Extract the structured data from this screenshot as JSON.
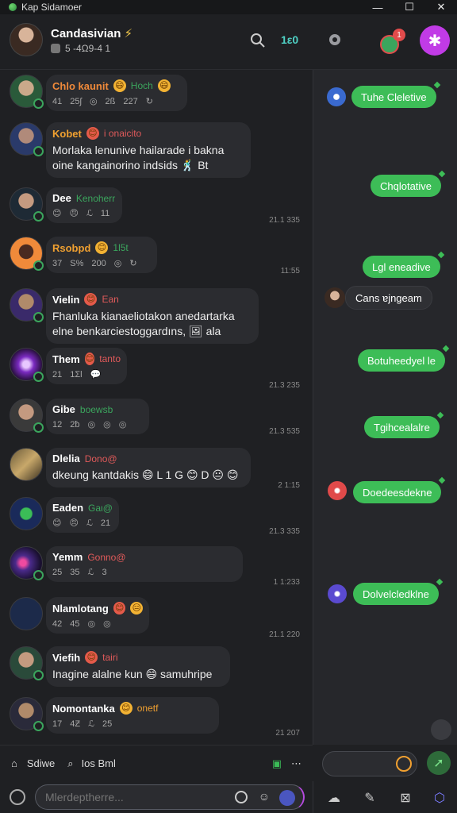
{
  "window": {
    "title": "Kap Sidamoer",
    "controls": [
      "—",
      "☐",
      "✕"
    ]
  },
  "header": {
    "contact_name": "Candasivian",
    "sparkle": "⚡",
    "subtitle": "5 -4Ω9-4 1",
    "count_label": "1ε0",
    "notification_badge": "1"
  },
  "messages": [
    {
      "name": "Chlo kaunit",
      "name_color": "#f08a3a",
      "tag": "Hoch",
      "tag_color": "#3ba55d",
      "meta": [
        "41",
        "25ʃ",
        "◎",
        "2ß",
        "227",
        "↻"
      ],
      "time": "",
      "text": ""
    },
    {
      "name": "Kobet",
      "name_color": "#f0a030",
      "tag": "i onaicito",
      "tag_color": "#e05a5a",
      "meta": [],
      "time": "",
      "text": "Morlaka lenunive hailarade i bakna oine kangainorino indsids 🕺 Bt"
    },
    {
      "name": "Dee",
      "name_color": "#ffffff",
      "tag": "Kenoherr",
      "tag_color": "#3ba55d",
      "meta": [
        "😊",
        "😠",
        "ℒ",
        "11"
      ],
      "time": "21.1 335",
      "text": ""
    },
    {
      "name": "Rsobpd",
      "name_color": "#f0a030",
      "tag": "1l5t",
      "tag_color": "#3ba55d",
      "meta": [
        "37",
        "S%",
        "200",
        "◎",
        "↻"
      ],
      "time": "11:55",
      "text": ""
    },
    {
      "name": "Vielin",
      "name_color": "#ffffff",
      "tag": "Ean",
      "tag_color": "#e05a5a",
      "meta": [],
      "time": "",
      "text": "Fhanluka kianaeliotakon anedartarka elne benkarciestoggardıns, 🖼 ala"
    },
    {
      "name": "Them",
      "name_color": "#ffffff",
      "tag": "tanto",
      "tag_color": "#e05a5a",
      "meta": [
        "21",
        "1Ʃl",
        "💬"
      ],
      "time": "21.3 235",
      "text": ""
    },
    {
      "name": "Gibe",
      "name_color": "#ffffff",
      "tag": "boewsb",
      "tag_color": "#3ba55d",
      "meta": [
        "12",
        "2ƀ",
        "◎",
        "◎",
        "◎"
      ],
      "time": "21.3 535",
      "text": ""
    },
    {
      "name": "Dlelia",
      "name_color": "#ffffff",
      "tag": "Dono@",
      "tag_color": "#e05a5a",
      "meta": [],
      "time": "2 1:15",
      "text": "dkeung kantdakis 😄 L 1 G 😊 D 😐 😊"
    },
    {
      "name": "Eaden",
      "name_color": "#ffffff",
      "tag": "Gaι@",
      "tag_color": "#3ba55d",
      "meta": [
        "😊",
        "😠",
        "ℒ",
        "21"
      ],
      "time": "21.3 335",
      "text": ""
    },
    {
      "name": "Yemm",
      "name_color": "#ffffff",
      "tag": "Gonno@",
      "tag_color": "#e05a5a",
      "meta": [
        "25",
        "35",
        "ℒ",
        "3"
      ],
      "time": "1 1:233",
      "text": ""
    },
    {
      "name": "Nlamlotang",
      "name_color": "#ffffff",
      "tag": "😑",
      "tag_color": "#f0a030",
      "meta": [
        "42",
        "45",
        "◎",
        "◎"
      ],
      "time": "21.1 220",
      "text": ""
    },
    {
      "name": "Viefih",
      "name_color": "#ffffff",
      "tag": "tairi",
      "tag_color": "#e05a5a",
      "meta": [],
      "time": "",
      "text": "Inagine alalne kun 😄 samuhripe"
    },
    {
      "name": "Nomontanka",
      "name_color": "#ffffff",
      "tag": "onetf",
      "tag_color": "#f0a030",
      "meta": [
        "17",
        "4Ƶ",
        "ℒ",
        "25"
      ],
      "time": "21 207",
      "text": ""
    }
  ],
  "right_panel": {
    "bubbles": [
      {
        "text": "Tuhe Cleletive",
        "kind": "green"
      },
      {
        "text": "Chqlotative",
        "kind": "green"
      },
      {
        "text": "Lgl eneadive",
        "kind": "green"
      },
      {
        "text": "Cans ɐjngeam",
        "kind": "dark"
      },
      {
        "text": "Botuheedyel le",
        "kind": "green"
      },
      {
        "text": "Tgihcealalre",
        "kind": "green"
      },
      {
        "text": "Doedeesdekne",
        "kind": "green"
      },
      {
        "text": "Dolvelcledklne",
        "kind": "green"
      }
    ]
  },
  "bottom_bar": {
    "items": [
      "Sdiwe",
      "Ios Bml"
    ],
    "input_placeholder": "Mlerdeptherre..."
  },
  "colors": {
    "accent_green": "#3dbd57",
    "accent_purple": "#c13be6",
    "bg": "#1f2023"
  }
}
